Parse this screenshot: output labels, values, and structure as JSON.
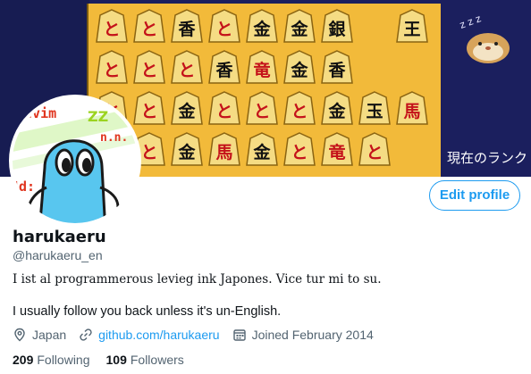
{
  "banner": {
    "board_pieces": [
      [
        "と",
        "と",
        "香",
        "と",
        "金",
        "金",
        "銀",
        "",
        "王"
      ],
      [
        "と",
        "と",
        "と",
        "香",
        "竜",
        "金",
        "香",
        "",
        ""
      ],
      [
        "と",
        "と",
        "金",
        "と",
        "と",
        "と",
        "金",
        "玉",
        "馬"
      ],
      [
        "",
        "と",
        "金",
        "馬",
        "金",
        "と",
        "竜",
        "と",
        ""
      ]
    ],
    "black_pieces": [
      "銀",
      "王",
      "香",
      "金",
      "玉",
      "金"
    ],
    "zzz": "z z z",
    "rank_text": "現在のランク"
  },
  "profile": {
    "name": "harukaeru",
    "handle": "@harukaeru_en",
    "edit_button": "Edit profile",
    "bio_line1": "I ist al programmerous levieg ink Japones. Vice tur mi to su.",
    "bio_line2": "I usually follow you back unless it's un-English.",
    "location": "Japan",
    "website": "github.com/harukaeru",
    "joined": "Joined February 2014",
    "following_count": "209",
    "following_label": "Following",
    "followers_count": "109",
    "followers_label": "Followers"
  },
  "colors": {
    "accent": "#1d9bf0",
    "board": "#f2ba3a",
    "banner_bg": "#1b1f5e"
  },
  "icons": [
    "location-icon",
    "link-icon",
    "calendar-icon"
  ]
}
